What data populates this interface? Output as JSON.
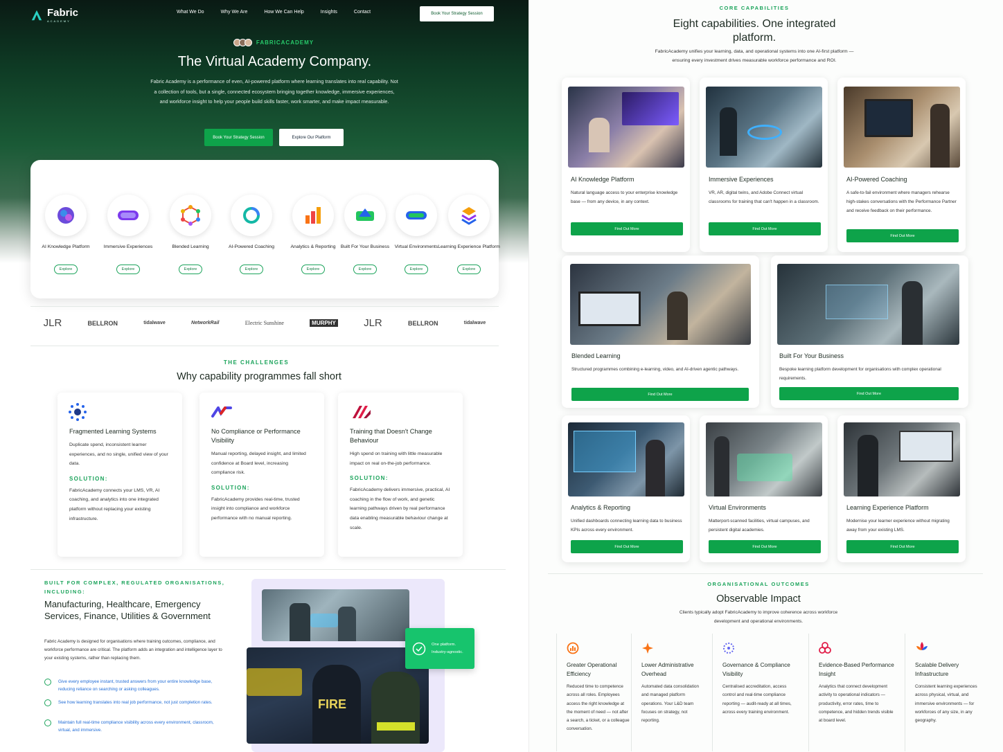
{
  "header": {
    "logo_text": "Fabric",
    "logo_sub": "ACADEMY",
    "nav": [
      "What We Do",
      "Why We Are",
      "How We Can Help",
      "Insights",
      "Contact"
    ],
    "cta": "Book Your Strategy Session"
  },
  "hero": {
    "eyebrow": "FABRICACADEMY",
    "title": "The Virtual Academy Company.",
    "desc": "Fabric Academy is a performance of even, AI-powered platform where learning translates into real capability. Not a collection of tools, but a single, connected ecosystem bringing together knowledge, immersive experiences, and workforce insight to help your people build skills faster, work smarter, and make impact measurable.",
    "btn_primary": "Book Your Strategy Session",
    "btn_secondary": "Explore Our Platform"
  },
  "capabilities_strip": {
    "items": [
      {
        "label": "AI Knowledge Platform",
        "btn": "Explore"
      },
      {
        "label": "Immersive Experiences",
        "btn": "Explore"
      },
      {
        "label": "Blended Learning",
        "btn": "Explore"
      },
      {
        "label": "AI-Powered Coaching",
        "btn": "Explore"
      },
      {
        "label": "Analytics & Reporting",
        "btn": "Explore"
      },
      {
        "label": "Built For Your Business",
        "btn": "Explore"
      },
      {
        "label": "Virtual Environments",
        "btn": "Explore"
      },
      {
        "label": "Learning Experience Platform",
        "btn": "Explore"
      }
    ]
  },
  "client_logos": [
    "JLR",
    "BELLRON",
    "tidalwave",
    "NetworkRail",
    "Electric Sunshine",
    "MURPHY",
    "JLR",
    "BELLRON",
    "tidalwave"
  ],
  "challenges": {
    "eyebrow": "THE CHALLENGES",
    "title": "Why capability programmes fall short",
    "cards": [
      {
        "title": "Fragmented Learning Systems",
        "text": "Duplicate spend, inconsistent learner experiences, and no single, unified view of your data.",
        "sol_label": "SOLUTION:",
        "solution": "FabricAcademy connects your LMS, VR, AI coaching, and analytics into one integrated platform without replacing your existing infrastructure."
      },
      {
        "title": "No Compliance or Performance Visibility",
        "text": "Manual reporting, delayed insight, and limited confidence at Board level, increasing compliance risk.",
        "sol_label": "SOLUTION:",
        "solution": "FabricAcademy provides real-time, trusted insight into compliance and workforce performance with no manual reporting."
      },
      {
        "title": "Training that Doesn't Change Behaviour",
        "text": "High spend on training with little measurable impact on real on-the-job performance.",
        "sol_label": "SOLUTION:",
        "solution": "FabricAcademy delivers immersive, practical, AI coaching in the flow of work, and genetic learning pathways driven by real performance data enabling measurable behaviour change at scale."
      }
    ]
  },
  "industries": {
    "eyebrow": "BUILT FOR COMPLEX, REGULATED ORGANISATIONS, INCLUDING:",
    "title": "Manufacturing, Healthcare, Emergency Services, Finance, Utilities & Government",
    "desc": "Fabric Academy is designed for organisations where training outcomes, compliance, and workforce performance are critical. The platform adds an integration and intelligence layer to your existing systems, rather than replacing them.",
    "checks": [
      "Give every employee instant, trusted answers from your entire knowledge base, reducing reliance on searching or asking colleagues.",
      "See how learning translates into real job performance, not just completion rates.",
      "Maintain full real-time compliance visibility across every environment, classroom, virtual, and immersive."
    ],
    "badge": "One platform. Industry-agnostic."
  },
  "core": {
    "eyebrow": "CORE CAPABILITIES",
    "title_line1": "Eight capabilities. One integrated",
    "title_line2": "platform.",
    "desc": "FabricAcademy unifies your learning, data, and operational systems into one AI-first platform — ensuring every investment drives measurable workforce performance and ROI.",
    "cards": [
      {
        "title": "AI Knowledge Platform",
        "text": "Natural language access to your enterprise knowledge base — from any device, in any context.",
        "btn": "Find Out More"
      },
      {
        "title": "Immersive Experiences",
        "text": "VR, AR, digital twins, and Adobe Connect virtual classrooms for training that can't happen in a classroom.",
        "btn": "Find Out More"
      },
      {
        "title": "AI-Powered Coaching",
        "text": "A safe-to-fail environment where managers rehearse high-stakes conversations with the Performance Partner and receive feedback on their performance.",
        "btn": "Find Out More"
      },
      {
        "title": "Blended Learning",
        "text": "Structured programmes combining e-learning, video, and AI-driven agentic pathways.",
        "btn": "Find Out More"
      },
      {
        "title": "Built For Your Business",
        "text": "Bespoke learning platform development for organisations with complex operational requirements.",
        "btn": "Find Out More"
      },
      {
        "title": "Analytics & Reporting",
        "text": "Unified dashboards connecting learning data to business KPIs across every environment.",
        "btn": "Find Out More"
      },
      {
        "title": "Virtual Environments",
        "text": "Matterport-scanned facilities, virtual campuses, and persistent digital academies.",
        "btn": "Find Out More"
      },
      {
        "title": "Learning Experience Platform",
        "text": "Modernise your learner experience without migrating away from your existing LMS.",
        "btn": "Find Out More"
      }
    ]
  },
  "outcomes": {
    "eyebrow": "ORGANISATIONAL OUTCOMES",
    "title": "Observable Impact",
    "desc": "Clients typically adopt FabricAcademy to improve coherence across workforce development and operational environments.",
    "items": [
      {
        "title": "Greater Operational Efficiency",
        "text": "Reduced time to competence across all roles. Employees access the right knowledge at the moment of need — not after a search, a ticket, or a colleague conversation."
      },
      {
        "title": "Lower Administrative Overhead",
        "text": "Automated data consolidation and managed platform operations. Your L&D team focuses on strategy, not reporting."
      },
      {
        "title": "Governance & Compliance Visibility",
        "text": "Centralised accreditation, access control and real-time compliance reporting — audit-ready at all times, across every training environment."
      },
      {
        "title": "Evidence-Based Performance Insight",
        "text": "Analytics that connect development activity to operational indicators — productivity, error rates, time to competence, and hidden trends visible at board level."
      },
      {
        "title": "Scalable Delivery Infrastructure",
        "text": "Consistent learning experiences across physical, virtual, and immersive environments — for workforces of any size, in any geography."
      }
    ]
  },
  "colors": {
    "brand_green": "#0ea34a",
    "accent_teal": "#27c96a",
    "hero_dark": "#0a1a14"
  }
}
